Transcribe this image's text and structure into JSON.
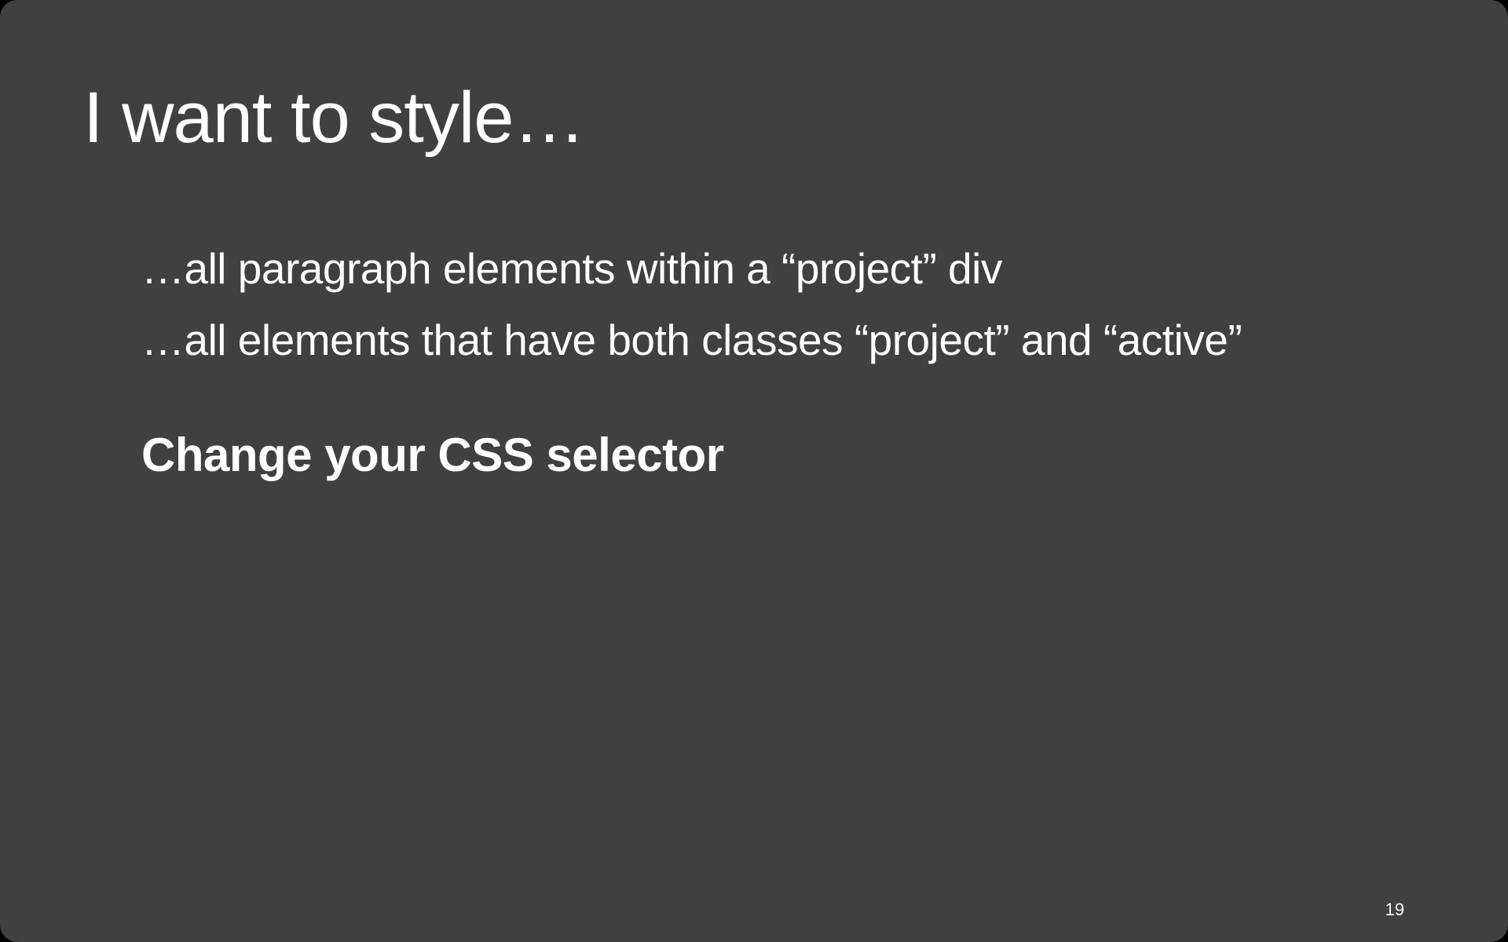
{
  "slide": {
    "title": "I want to style…",
    "bullets": [
      "…all paragraph elements within a “project” div",
      "…all elements that have both classes “project” and “active”"
    ],
    "emphasis": "Change your CSS selector",
    "page_number": "19"
  },
  "colors": {
    "background": "#404040",
    "text": "#ffffff"
  }
}
